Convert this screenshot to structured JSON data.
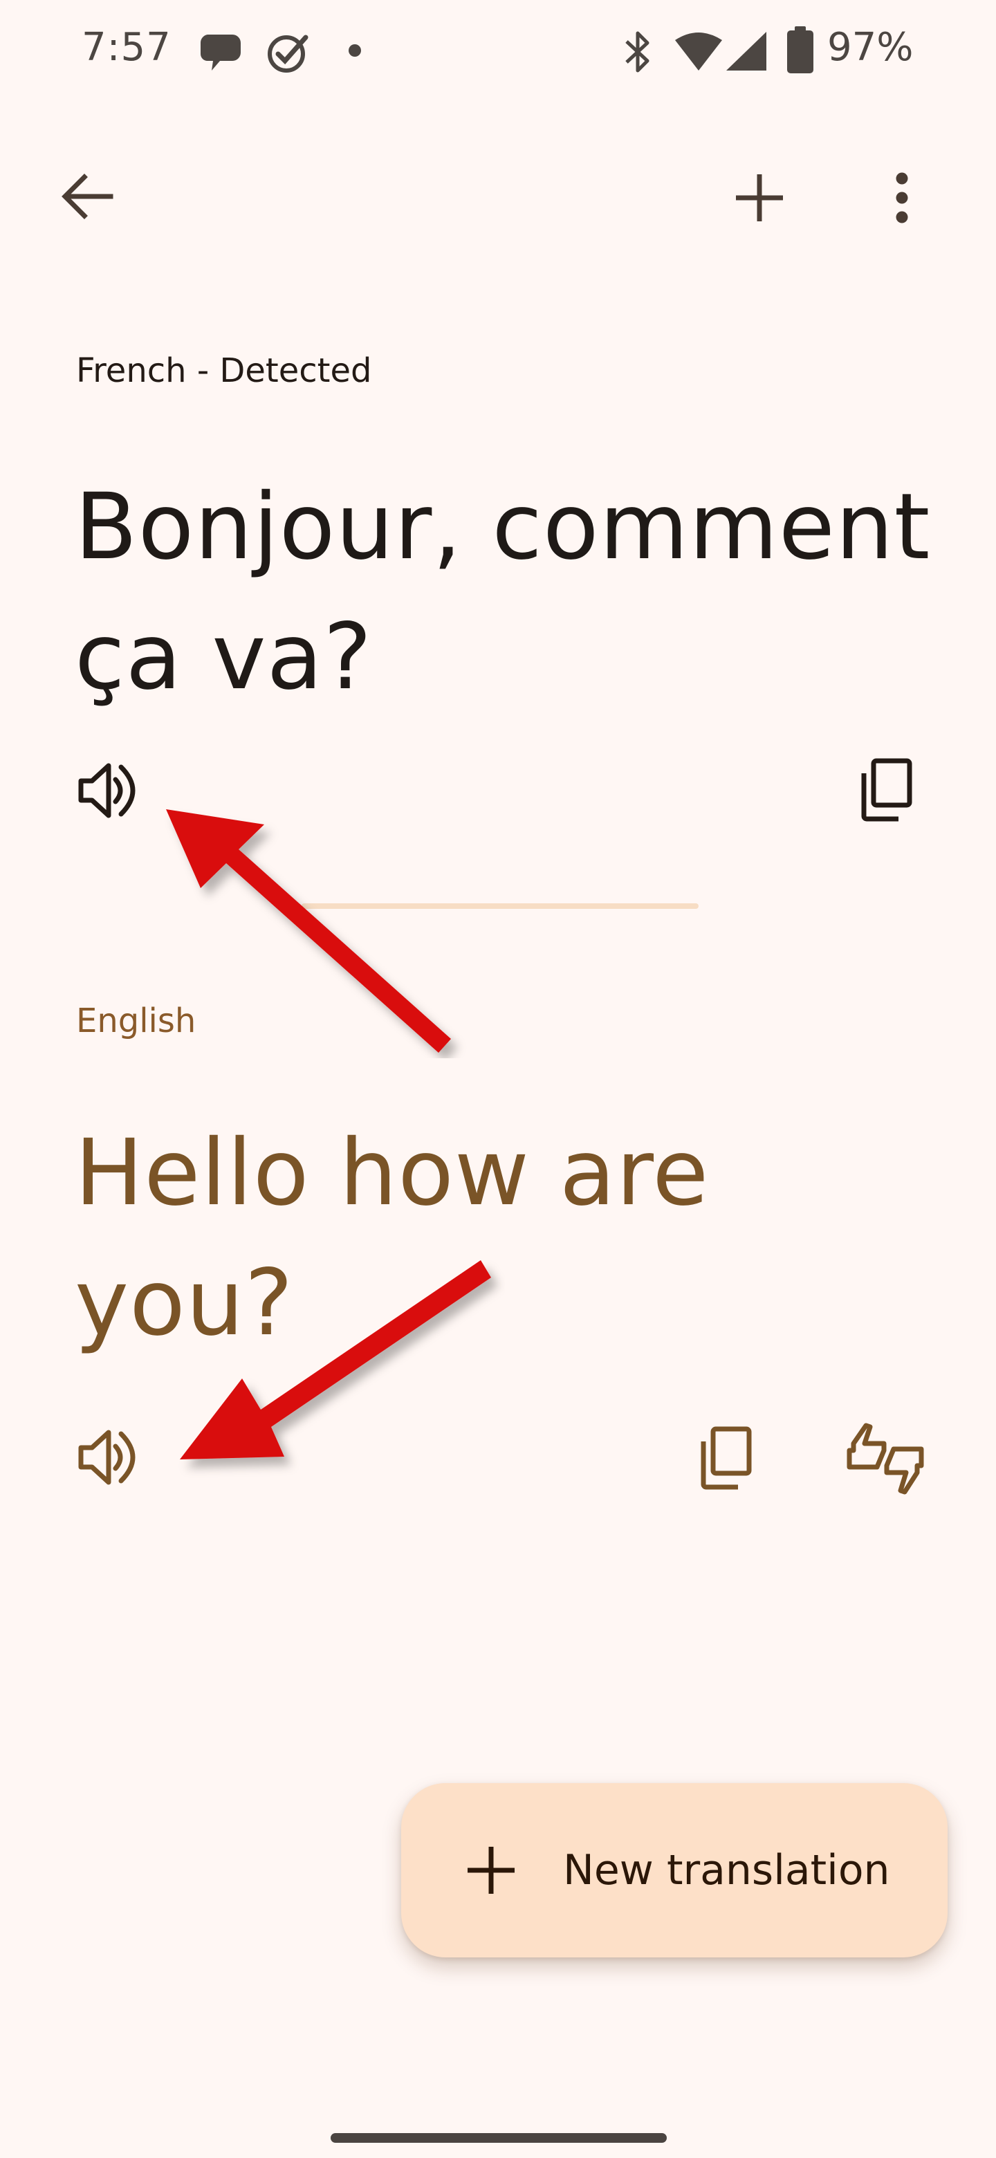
{
  "status_bar": {
    "time": "7:57",
    "battery_percent": "97%",
    "icons": [
      "chat-bubble-icon",
      "check-circle-icon",
      "dot-icon",
      "bluetooth-icon",
      "wifi-icon",
      "signal-icon",
      "battery-icon"
    ]
  },
  "top_bar": {
    "icons": [
      "back-arrow-icon",
      "plus-icon",
      "more-vert-icon"
    ]
  },
  "source": {
    "language_label": "French - Detected",
    "text": "Bonjour, comment ça va?"
  },
  "target": {
    "language_label": "English",
    "text": "Hello how are you?"
  },
  "fab": {
    "label": "New translation"
  },
  "colors": {
    "background": "#fff7f4",
    "target_text": "#7a5427",
    "fab_background": "#fde0c8",
    "arrow_annotation": "#d90b0b"
  }
}
